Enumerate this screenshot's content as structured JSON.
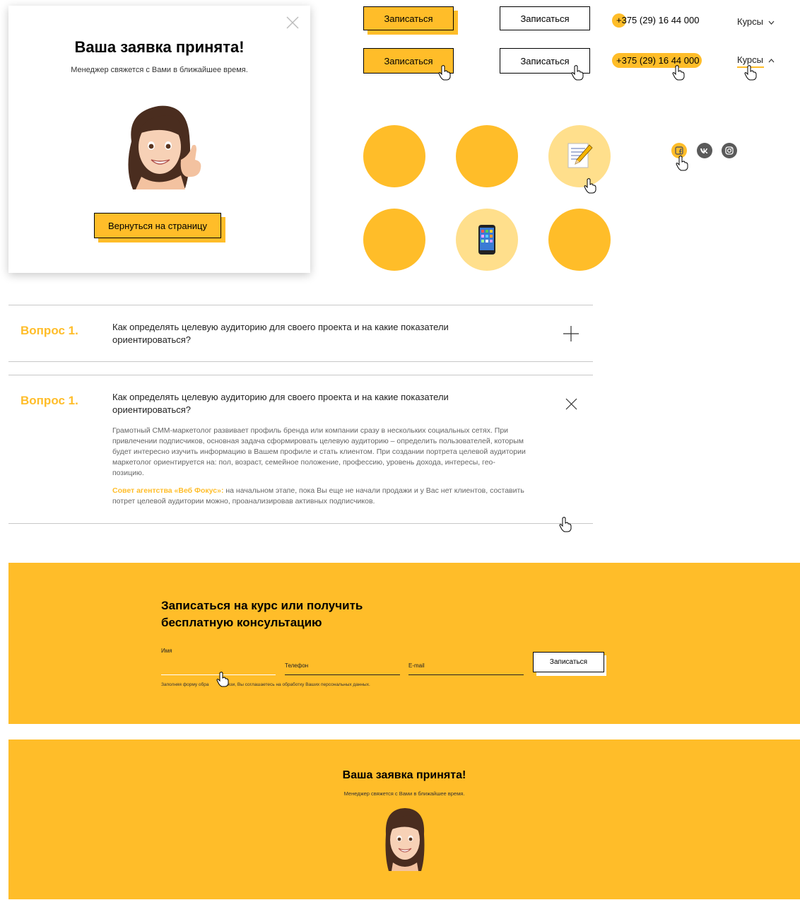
{
  "modal": {
    "title": "Ваша заявка принята!",
    "subtitle": "Менеджер свяжется с Вами в ближайшее время.",
    "button": "Вернуться на страницу"
  },
  "buttons": {
    "signup": "Записаться"
  },
  "phone": "+375 (29) 16 44 000",
  "courses": "Курсы",
  "faq": [
    {
      "label": "Вопрос 1.",
      "question": "Как определять целевую аудиторию для своего проекта и на какие показатели ориентироваться?"
    },
    {
      "label": "Вопрос 1.",
      "question": "Как определять целевую аудиторию для своего проекта и на какие показатели ориентироваться?",
      "answer": "Грамотный СММ-маркетолог развивает профиль бренда или компании сразу в нескольких социальных сетях. При привлечении подписчиков, основная задача сформировать целевую аудиторию – определить пользователей, которым будет интересно изучить информацию в Вашем профиле и стать клиентом. При создании портрета целевой аудитории маркетолог ориентируется на: пол, возраст, семейное положение, профессию, уровень дохода, интересы, гео-позицию.",
      "tip_label": "Совет агентства «Веб Фокус»:",
      "tip_text": " на начальном этапе, пока Вы еще не начали продажи и у Вас нет клиентов, составить потрет целевой аудитории можно, проанализировав активных подписчиков."
    }
  ],
  "form": {
    "title": "Записаться на курс или получить бесплатную консультацию",
    "name_label": "Имя",
    "phone_label": "Телефон",
    "email_label": "E-mail",
    "submit": "Записаться",
    "consent_a": "Заполняя форму обра",
    "consent_b": "связи, Вы соглашаетесь на обработку Ваших персональных данных."
  },
  "success": {
    "title": "Ваша заявка принята!",
    "subtitle": "Менеджер свяжется с Вами в ближайшее время."
  },
  "colors": {
    "accent": "#ffbd29",
    "accent_light": "#ffdf8c",
    "social_gray": "#5a5a5a"
  },
  "icons": [
    "close-icon",
    "chevron-down-icon",
    "chevron-up-icon",
    "facebook-icon",
    "vk-icon",
    "instagram-icon",
    "plus-icon",
    "close-x-icon",
    "memo-emoji-icon",
    "phone-emoji-icon",
    "hand-pointer-icon"
  ]
}
